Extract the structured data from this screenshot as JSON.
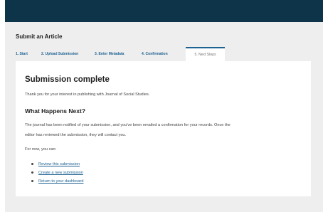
{
  "header": {
    "bar_color": "#0d3449"
  },
  "page": {
    "title": "Submit an Article"
  },
  "tabs": [
    {
      "label": "1. Start",
      "state": "completed"
    },
    {
      "label": "2. Upload Submission",
      "state": "completed"
    },
    {
      "label": "3. Enter Metadata",
      "state": "completed"
    },
    {
      "label": "4. Confirmation",
      "state": "completed"
    },
    {
      "label": "5. Next Steps",
      "state": "active"
    }
  ],
  "panel": {
    "heading": "Submission complete",
    "thanks": "Thank you for your interest in publishing with Journal of Social Studies.",
    "next_heading": "What Happens Next?",
    "notified_line1": "The journal has been notified of your submission, and you've been emailed a confirmation for your records. Once the",
    "notified_line2": "editor has reviewed the submission, they will contact you.",
    "for_now": "For now, you can:",
    "links": [
      "Review this submission",
      "Create a new submission",
      "Return to your dashboard"
    ]
  },
  "colors": {
    "accent": "#1e6292",
    "background": "#eeeeee",
    "panel": "#ffffff"
  }
}
